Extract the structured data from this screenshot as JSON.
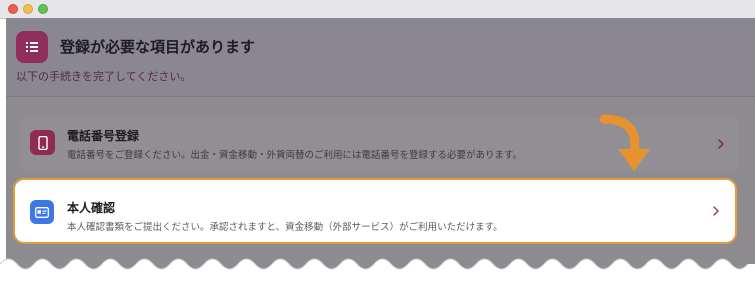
{
  "header": {
    "title": "登録が必要な項目があります",
    "subtitle": "以下の手続きを完了してください。",
    "icon": "checklist-icon"
  },
  "items": [
    {
      "title": "電話番号登録",
      "description": "電話番号をご登録ください。出金・資金移動・外貨両替のご利用には電話番号を登録する必要があります。",
      "icon": "phone-icon",
      "highlighted": false
    },
    {
      "title": "本人確認",
      "description": "本人確認書類をご提出ください。承認されますと、資金移動（外部サービス）がご利用いただけます。",
      "icon": "id-card-icon",
      "highlighted": true
    }
  ],
  "colors": {
    "highlight_border": "#e69a3a",
    "annotation_arrow": "#e8922e",
    "brand": "#8f2d5b",
    "id_icon": "#3d77e4"
  }
}
